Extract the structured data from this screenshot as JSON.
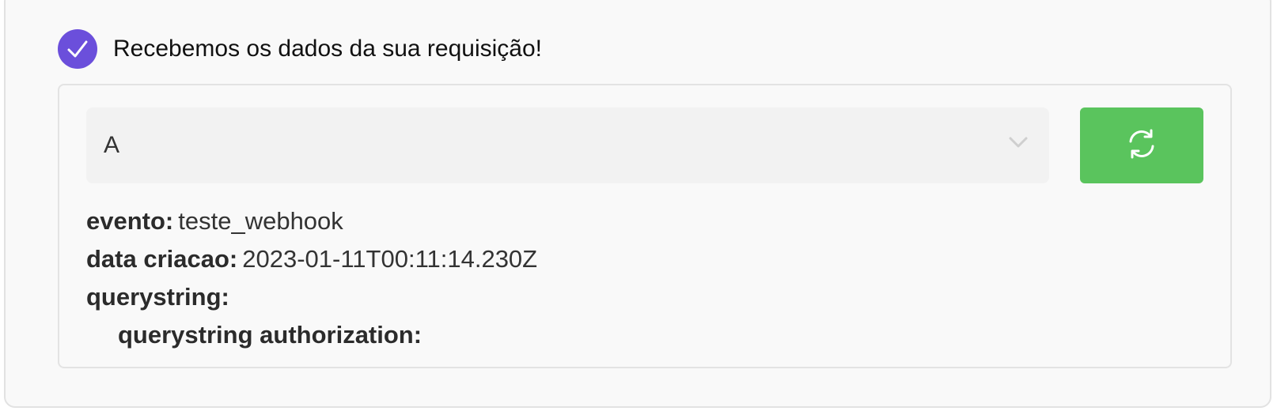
{
  "status": {
    "message": "Recebemos os dados da sua requisição!",
    "check_icon": "check-icon",
    "accent_color": "#6b4fdb"
  },
  "selector": {
    "value": "A",
    "icon": "chevron-down-icon"
  },
  "refresh_button": {
    "icon": "refresh-icon",
    "color": "#5ac45d"
  },
  "details": [
    {
      "key": "evento:",
      "value": "teste_webhook"
    },
    {
      "key": "data criacao:",
      "value": "2023-01-11T00:11:14.230Z"
    },
    {
      "key": "querystring:",
      "value": ""
    },
    {
      "key": "querystring authorization:",
      "value": ""
    }
  ]
}
